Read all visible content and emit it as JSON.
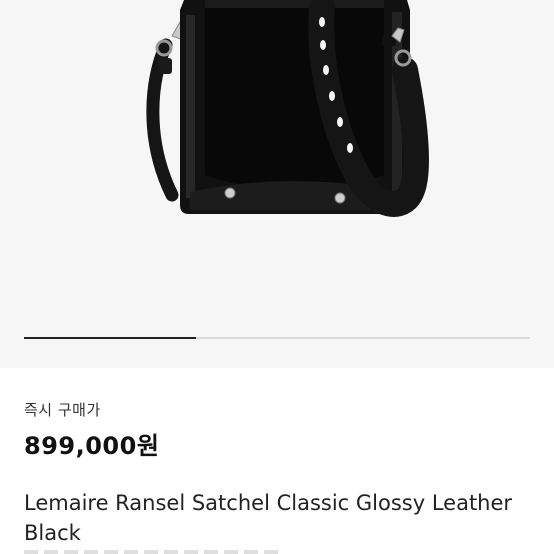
{
  "product": {
    "image_label": "bag-product-photo",
    "purchase_label": "즉시 구매가",
    "price": "899,000원",
    "title": "Lemaire Ransel Satchel Classic Glossy Leather Black"
  },
  "gallery": {
    "progress": 0.34,
    "background_color": "#f6f6f6"
  },
  "colors": {
    "text_primary": "#111111",
    "text_secondary": "#333333",
    "bag_black": "#151515"
  }
}
